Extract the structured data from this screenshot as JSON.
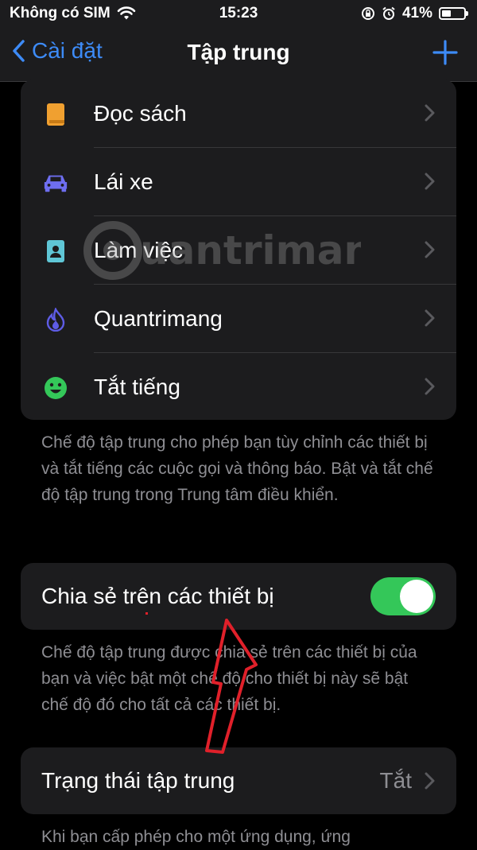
{
  "status_bar": {
    "carrier": "Không có SIM",
    "time": "15:23",
    "battery": "41%",
    "battery_level": 0.41
  },
  "nav": {
    "back_label": "Cài đặt",
    "title": "Tập trung"
  },
  "focus_modes": [
    {
      "label": "Đọc sách",
      "icon": "book-icon",
      "color": "#f0a030"
    },
    {
      "label": "Lái xe",
      "icon": "car-icon",
      "color": "#6e6ef0"
    },
    {
      "label": "Làm việc",
      "icon": "id-badge-icon",
      "color": "#5fc6d6"
    },
    {
      "label": "Quantrimang",
      "icon": "flame-icon",
      "color": "#5e5ce6"
    },
    {
      "label": "Tắt tiếng",
      "icon": "smiley-icon",
      "color": "#34c759"
    }
  ],
  "focus_footnote": "Chế độ tập trung cho phép bạn tùy chỉnh các thiết bị và tắt tiếng các cuộc gọi và thông báo. Bật và tắt chế độ tập trung trong Trung tâm điều khiển.",
  "share": {
    "label": "Chia sẻ trên các thiết bị",
    "enabled": true,
    "footnote": "Chế độ tập trung được chia sẻ trên các thiết bị của bạn và việc bật một chế độ cho thiết bị này sẽ bật chế độ đó cho tất cả các thiết bị."
  },
  "focus_status": {
    "label": "Trạng thái tập trung",
    "value": "Tắt",
    "footnote": "Khi bạn cấp phép cho một ứng dụng, ứng"
  },
  "watermark": "uantrimang",
  "colors": {
    "accent": "#3d8bf7",
    "toggle_on": "#34c759",
    "annotation": "#e0202a"
  }
}
